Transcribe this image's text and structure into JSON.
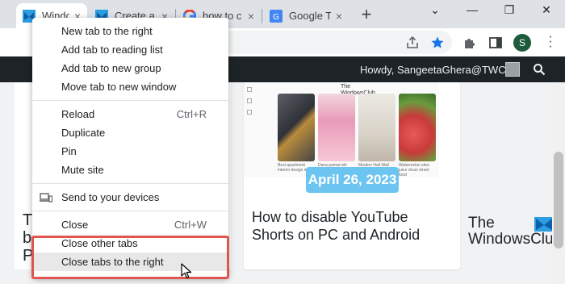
{
  "tabs": [
    {
      "title": "Window",
      "favicon": "windows-club-icon",
      "active": true
    },
    {
      "title": "Create a",
      "favicon": "windows-club-icon",
      "active": false
    },
    {
      "title": "how to c",
      "favicon": "google-icon",
      "active": false
    },
    {
      "title": "Google T",
      "favicon": "google-translate-icon",
      "active": false
    }
  ],
  "tab_close_glyph": "×",
  "new_tab_glyph": "+",
  "window_controls": {
    "tab_search": "⌄",
    "minimize": "—",
    "restore": "❐",
    "close": "✕"
  },
  "profile_initial": "S",
  "admin_bar": {
    "greeting": "Howdy, SangeetaGhera@TWC"
  },
  "page": {
    "left_teaser": "Th\nb\nP",
    "article_title": "How to disable YouTube Shorts on PC and Android",
    "date_badge": "April 26, 2023",
    "thumb_brand": "The\nWindowsClub",
    "thumb_captions": [
      "Best apartment interior design ideas",
      "Dana pamai wih bhaiiya",
      "Modern Hall Wall Decor Ideas",
      "Watermelon slice juice clean street food"
    ],
    "logo_line1": "The",
    "logo_line2": "WindowsClub"
  },
  "context_menu": {
    "items": [
      {
        "label": "New tab to the right",
        "shortcut": ""
      },
      {
        "label": "Add tab to reading list",
        "shortcut": ""
      },
      {
        "label": "Add tab to new group",
        "shortcut": ""
      },
      {
        "label": "Move tab to new window",
        "shortcut": ""
      },
      {
        "label": "Reload",
        "shortcut": "Ctrl+R"
      },
      {
        "label": "Duplicate",
        "shortcut": ""
      },
      {
        "label": "Pin",
        "shortcut": ""
      },
      {
        "label": "Mute site",
        "shortcut": ""
      },
      {
        "label": "Send to your devices",
        "shortcut": "",
        "icon": "devices-icon"
      },
      {
        "label": "Close",
        "shortcut": "Ctrl+W"
      },
      {
        "label": "Close other tabs",
        "shortcut": ""
      },
      {
        "label": "Close tabs to the right",
        "shortcut": "",
        "hovered": true
      }
    ]
  },
  "colors": {
    "highlight_border": "#e0564f",
    "date_badge": "#6cc5f0",
    "admin_bar": "#1d2327",
    "accent_star": "#1a73e8"
  }
}
